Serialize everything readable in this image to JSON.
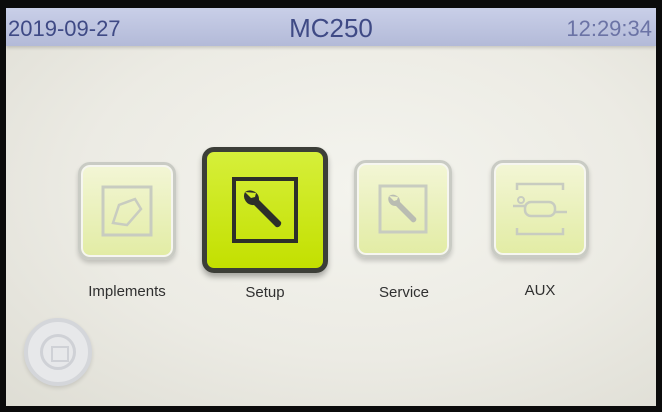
{
  "header": {
    "date": "2019-09-27",
    "title": "MC250",
    "time": "12:29:34"
  },
  "menu": {
    "items": [
      {
        "id": "implements",
        "label": "Implements",
        "icon": "implement-icon",
        "active": false
      },
      {
        "id": "setup",
        "label": "Setup",
        "icon": "wrench-icon",
        "active": true
      },
      {
        "id": "service",
        "label": "Service",
        "icon": "wrench-icon",
        "active": false
      },
      {
        "id": "aux",
        "label": "AUX",
        "icon": "aux-valve-icon",
        "active": false
      }
    ]
  },
  "nav": {
    "home_button_icon": "menu-icon"
  },
  "colors": {
    "header_bg": "#b3bad8",
    "header_text": "#3f4a85",
    "active_tile": "#c3e000",
    "inactive_tile": "#e2eca4",
    "screen_bg": "#ecebe4"
  }
}
